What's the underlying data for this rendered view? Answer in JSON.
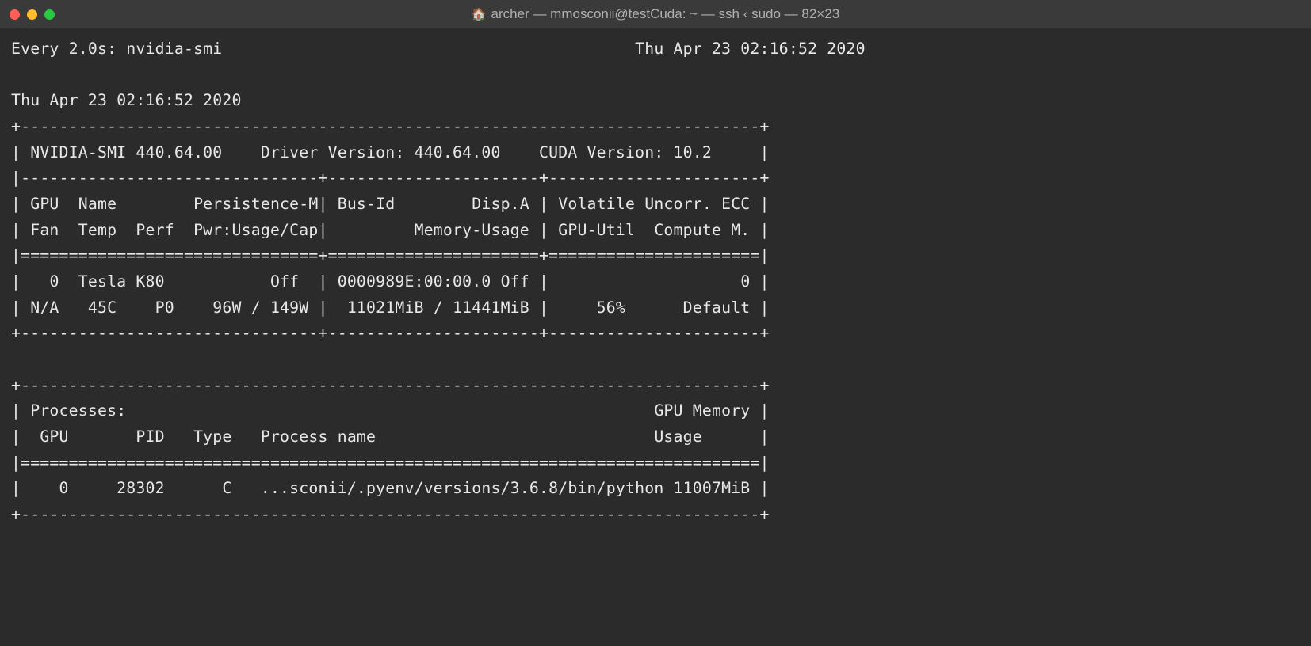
{
  "window": {
    "title": "archer — mmosconii@testCuda: ~ — ssh ‹ sudo — 82×23"
  },
  "watch": {
    "header_left": "Every 2.0s: nvidia-smi",
    "header_right": "Thu Apr 23 02:16:52 2020"
  },
  "smi": {
    "timestamp": "Thu Apr 23 02:16:52 2020",
    "version_label": "NVIDIA-SMI",
    "version": "440.64.00",
    "driver_label": "Driver Version:",
    "driver": "440.64.00",
    "cuda_label": "CUDA Version:",
    "cuda": "10.2",
    "hdr": {
      "gpu": "GPU",
      "name": "Name",
      "persistence": "Persistence-M",
      "busid": "Bus-Id",
      "dispa": "Disp.A",
      "volatile": "Volatile Uncorr. ECC",
      "fan": "Fan",
      "temp": "Temp",
      "perf": "Perf",
      "pwr": "Pwr:Usage/Cap",
      "memusage": "Memory-Usage",
      "gpuutil": "GPU-Util",
      "compute": "Compute M."
    },
    "gpu0": {
      "idx": "0",
      "name": "Tesla K80",
      "persistence": "Off",
      "busid": "0000989E:00:00.0",
      "dispa": "Off",
      "ecc": "0",
      "fan": "N/A",
      "temp": "45C",
      "perf": "P0",
      "pwr": "96W / 149W",
      "mem": "11021MiB / 11441MiB",
      "util": "56%",
      "compute": "Default"
    },
    "proc": {
      "header": "Processes:",
      "mem_hdr": "GPU Memory",
      "gpu_col": "GPU",
      "pid_col": "PID",
      "type_col": "Type",
      "name_col": "Process name",
      "usage_col": "Usage",
      "row": {
        "gpu": "0",
        "pid": "28302",
        "type": "C",
        "name": "...sconii/.pyenv/versions/3.6.8/bin/python",
        "mem": "11007MiB"
      }
    }
  }
}
